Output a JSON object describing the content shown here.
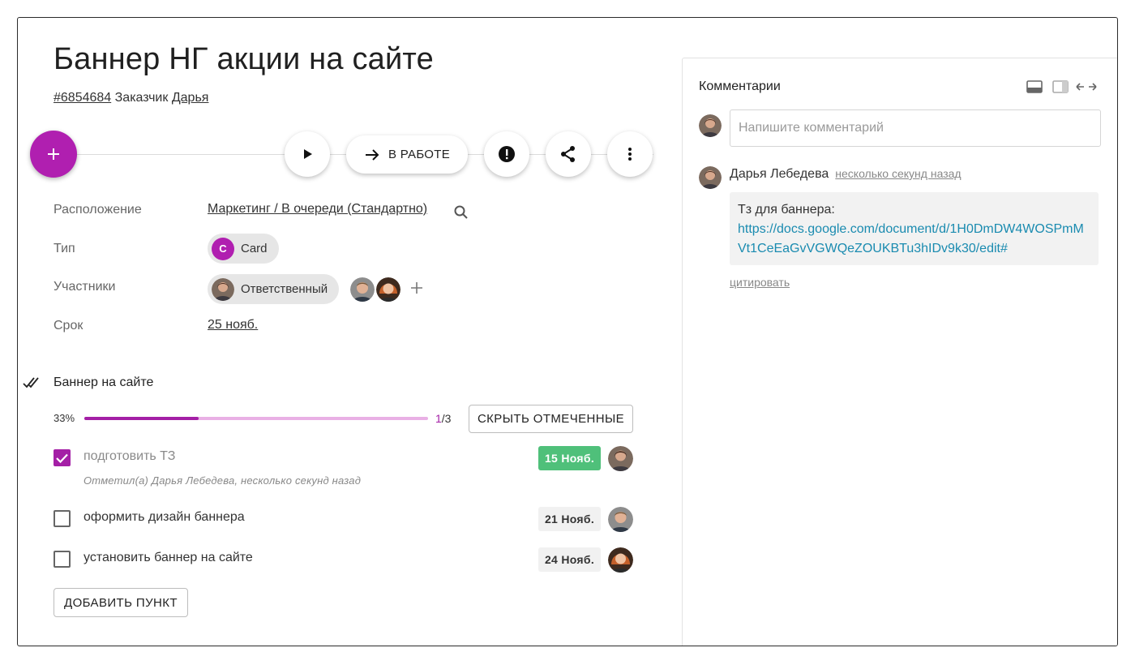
{
  "task": {
    "title": "Баннер НГ акции на сайте",
    "id": "#6854684",
    "customer_label": "Заказчик",
    "customer_name": "Дарья"
  },
  "toolbar": {
    "add_icon": "plus-icon",
    "play_icon": "play-icon",
    "status_icon": "arrow-right-icon",
    "status_label": "В РАБОТЕ",
    "priority_icon": "exclamation-circle-icon",
    "share_icon": "share-icon",
    "more_icon": "more-vert-icon"
  },
  "properties": {
    "location_label": "Расположение",
    "location_value": "Маркетинг / В очереди (Стандартно)",
    "type_label": "Тип",
    "type_badge": "C",
    "type_value": "Card",
    "members_label": "Участники",
    "responsible_label": "Ответственный",
    "due_label": "Срок",
    "due_value": "25 нояб."
  },
  "checklist": {
    "title": "Баннер на сайте",
    "progress_percent": "33%",
    "progress_fraction": 0.333,
    "done": "1",
    "total": "/3",
    "hide_checked_label": "СКРЫТЬ ОТМЕЧЕННЫЕ",
    "add_item_label": "ДОБАВИТЬ ПУНКТ",
    "items": [
      {
        "text": "подготовить ТЗ",
        "checked": true,
        "meta": "Отметил(а) Дарья Лебедева, несколько секунд назад",
        "date": "15 Нояб.",
        "date_color": "#4fc07a"
      },
      {
        "text": "оформить дизайн баннера",
        "checked": false,
        "date": "21 Нояб."
      },
      {
        "text": "установить баннер на сайте",
        "checked": false,
        "date": "24 Нояб."
      }
    ]
  },
  "comments": {
    "title": "Комментарии",
    "input_placeholder": "Напишите комментарий",
    "entries": [
      {
        "author": "Дарья Лебедева",
        "time": "несколько секунд назад",
        "text": "Тз для баннера:",
        "link": "https://docs.google.com/document/d/1H0DmDW4WOSPmMVt1CeEaGvVGWQeZOUKBTu3hIDv9k30/edit#",
        "quote_label": "цитировать"
      }
    ]
  },
  "colors": {
    "accent": "#b01fb0",
    "progress_fill": "#a41fa6",
    "progress_track": "#e9b0e5",
    "date_green": "#4fc07a",
    "link": "#1a8bb0"
  }
}
